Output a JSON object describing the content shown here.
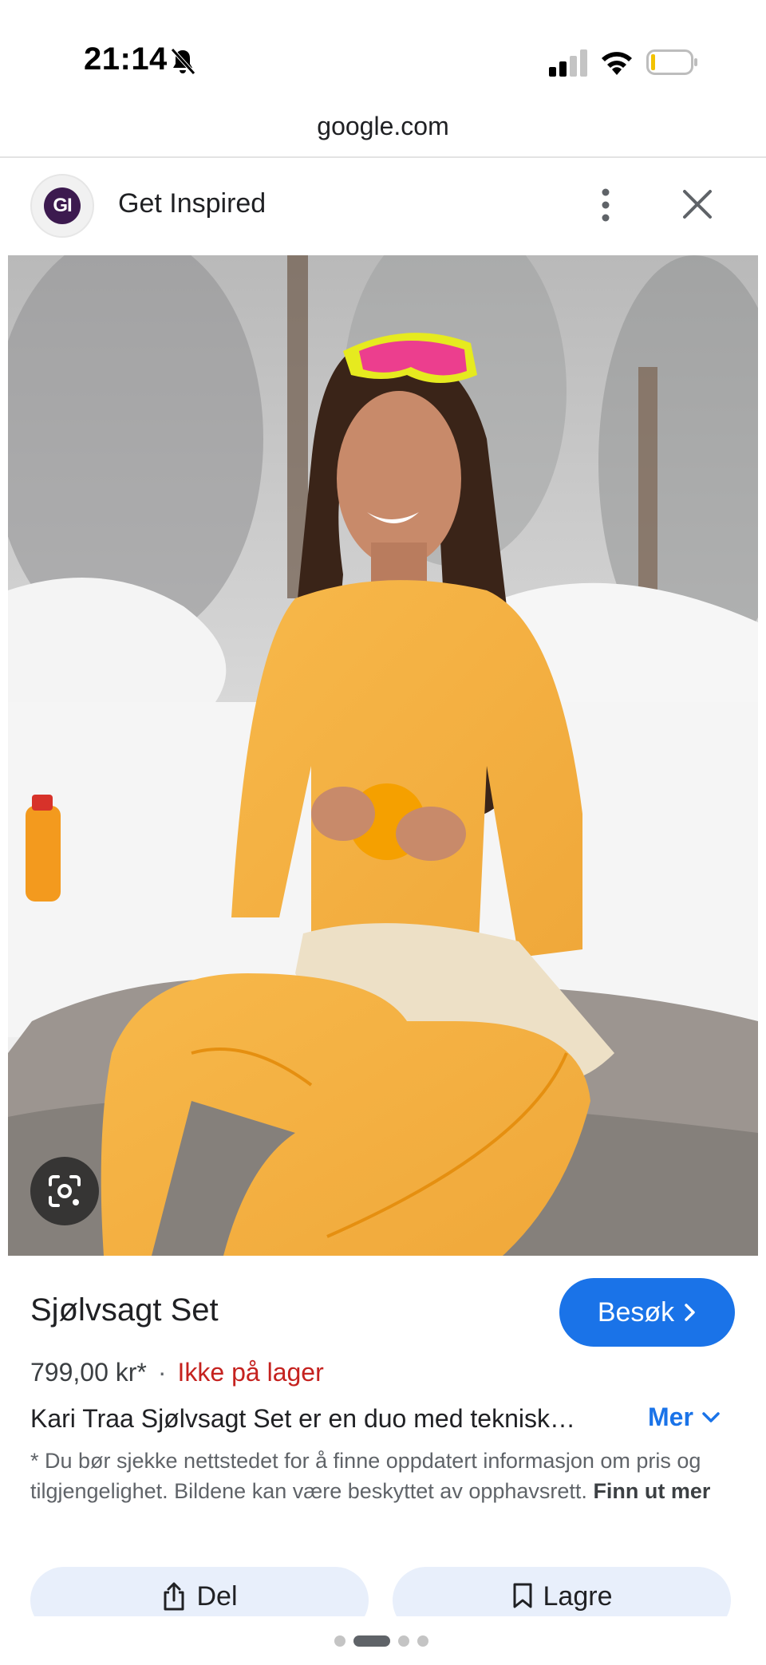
{
  "status_bar": {
    "time": "21:14",
    "icons": [
      "bell-slash-icon",
      "signal-icon",
      "wifi-icon",
      "battery-icon"
    ]
  },
  "browser": {
    "url": "google.com"
  },
  "header": {
    "avatar_text": "GI",
    "site_name": "Get Inspired",
    "icons": [
      "more-vertical-icon",
      "close-icon"
    ]
  },
  "image": {
    "icons": [
      "google-lens-icon"
    ]
  },
  "product": {
    "title": "Sjølvsagt Set",
    "visit_label": "Besøk",
    "price": "799,00 kr*",
    "separator": "·",
    "stock": "Ikke på lager",
    "description": "Kari Traa Sjølvsagt Set er en duo med teknisk…",
    "more_label": "Mer",
    "disclaimer": "* Du bør sjekke nettstedet for å finne oppdatert informasjon om pris og tilgjengelighet. Bildene kan være beskyttet av opphavsrett.",
    "disclaimer_link": "Finn ut mer"
  },
  "actions": {
    "share_label": "Del",
    "save_label": "Lagre"
  },
  "pager": {
    "count": 4,
    "active_index": 1
  },
  "colors": {
    "accent": "#1a73e8",
    "stock_red": "#c5221f",
    "action_bg": "#e8effb"
  }
}
